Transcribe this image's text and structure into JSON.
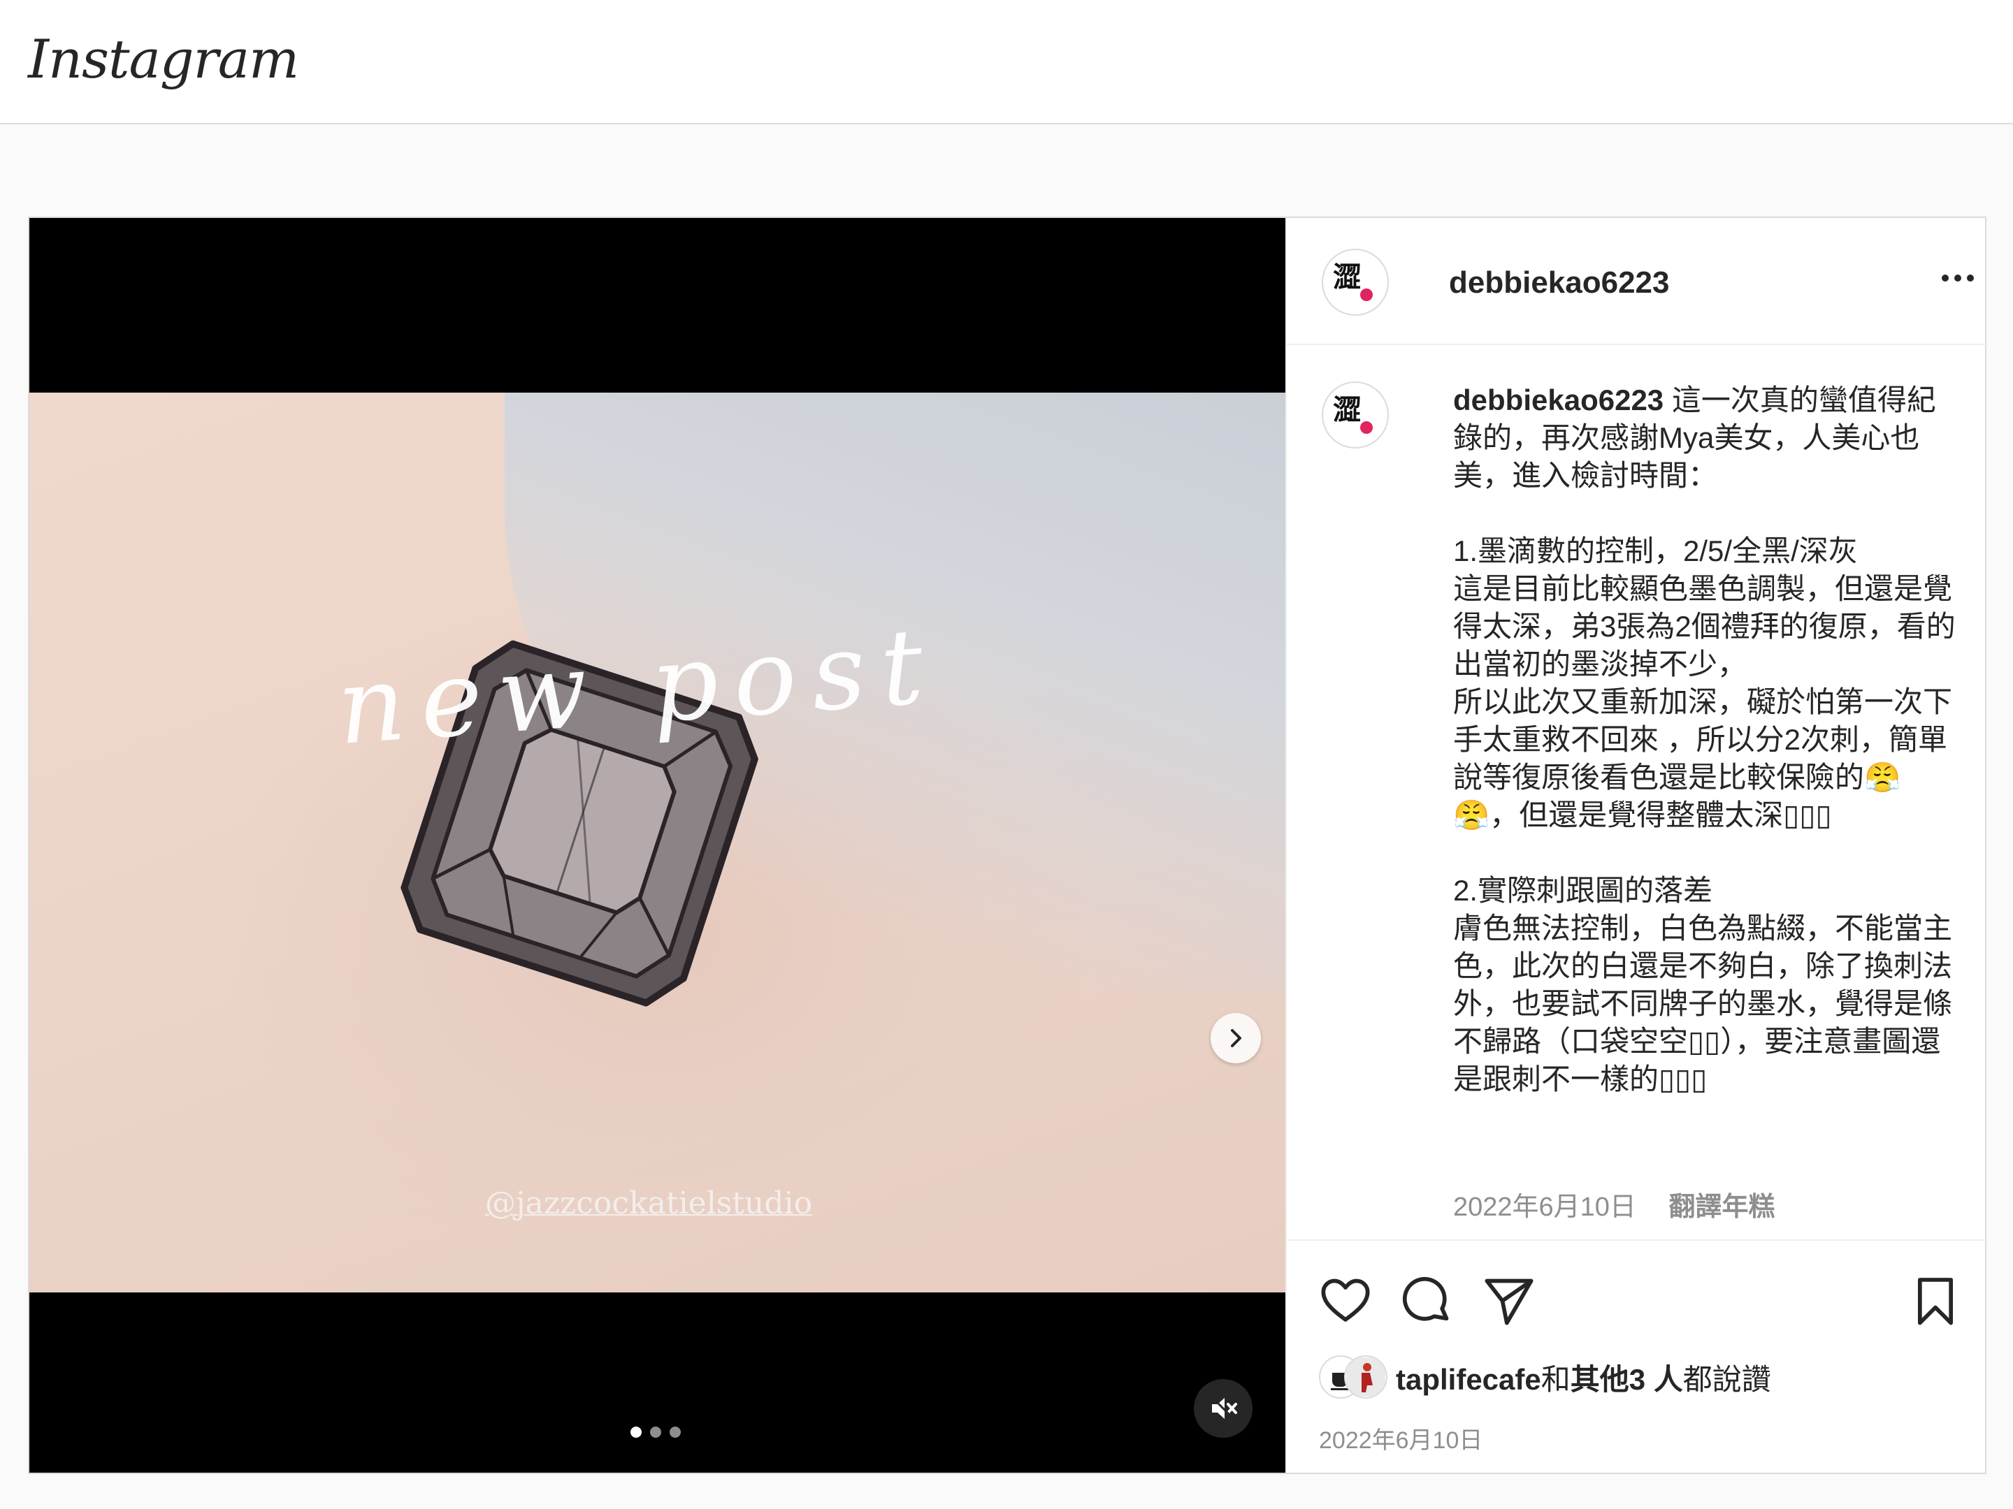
{
  "header": {
    "logo": "Instagram"
  },
  "media": {
    "overlay_text": "new post",
    "watermark": "@jazzcockatielstudio",
    "carousel_count": 3,
    "active_index": 0,
    "next_icon": "chevron-right-icon",
    "mute_icon": "speaker-muted-icon"
  },
  "post": {
    "username": "debbiekao6223",
    "more_icon": "more-horizontal-icon",
    "caption_username": "debbiekao6223",
    "caption_text": " 這一次真的蠻值得紀錄的，再次感謝Mya美女，人美心也美，進入檢討時間：\n\n1.墨滴數的控制，2/5/全黑/深灰\n這是目前比較顯色墨色調製，但還是覺得太深，弟3張為2個禮拜的復原，看的出當初的墨淡掉不少，\n所以此次又重新加深，礙於怕第一次下手太重救不回來 ，所以分2次刺，簡單說等復原後看色還是比較保險的😤😤，但還是覺得整體太深▯▯▯\n\n2.實際刺跟圖的落差\n膚色無法控制，白色為點綴，不能當主色，此次的白還是不夠白，除了換刺法外，也要試不同牌子的墨水，覺得是條不歸路（口袋空空▯▯），要注意畫圖還是跟刺不一樣的▯▯▯",
    "caption_date": "2022年6月10日",
    "translate_label": "翻譯年糕",
    "liked_by_user": "taplifecafe",
    "liked_by_rest": "和其他3 人都說讚",
    "liked_by_connector": "和",
    "liked_by_others": "其他3 人",
    "liked_by_suffix": "都說讚",
    "post_date": "2022年6月10日"
  },
  "colors": {
    "text": "#262626",
    "secondary": "#8e8e8e",
    "border": "#dbdbdb",
    "avatar_accent": "#e0245e"
  }
}
